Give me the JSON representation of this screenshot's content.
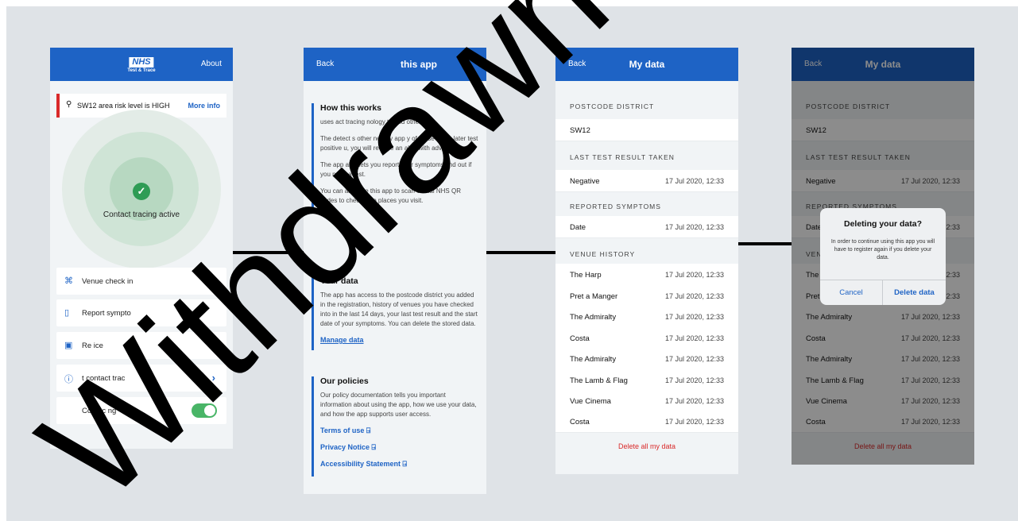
{
  "colors": {
    "nhs_blue": "#1e63c5",
    "alert_red": "#d92a2a",
    "success_green": "#2f9c55",
    "toggle_green": "#49b567"
  },
  "home": {
    "logo_text": "NHS",
    "logo_sub": "Test & Trace",
    "about": "About",
    "risk_text": "SW12 area risk level is HIGH",
    "more_info": "More info",
    "status": "Contact tracing active",
    "menu": [
      {
        "icon": "qr-code-icon",
        "label": "Venue check in"
      },
      {
        "icon": "clipboard-icon",
        "label": "Report sympto"
      },
      {
        "icon": "device-icon",
        "label": "Re              ice"
      },
      {
        "icon": "info-icon",
        "label": "t contact trac"
      }
    ],
    "toggle_label": "Contac          ng"
  },
  "about": {
    "back": "Back",
    "title": "this app",
    "how_title": "How this        works",
    "how_p1": "       uses      act tracing      nology to              and others.",
    "how_p2": "The        detect       s other nearby app        y of those users later test positive          u, you will receive an alert with advic",
    "how_p3": "The app also lets you report your symptoms     find out if you need a test.",
    "how_p4": "You can also use this app to scan official NHS QR codes to check in to places you visit.",
    "data_title": "Your data",
    "data_p": "The app has access to the postcode district you added in the registration, history of venues you have checked into in the last 14 days, your last test result and the start date of your symptoms. You can delete the stored data.",
    "manage": "Manage data",
    "pol_title": "Our policies",
    "pol_p": "Our policy documentation tells you important information about using the app, how we use your data, and how the app supports user access.",
    "terms": "Terms of use ⍈",
    "privacy": "Privacy Notice ⍈",
    "access": "Accessibility Statement ⍈"
  },
  "mydata": {
    "back": "Back",
    "title": "My data",
    "postcode_header": "POSTCODE DISTRICT",
    "postcode": "SW12",
    "test_header": "LAST TEST RESULT TAKEN",
    "test_result": "Negative",
    "test_date": "17 Jul 2020, 12:33",
    "symptoms_header": "REPORTED SYMPTOMS",
    "symptoms_label": "Date",
    "symptoms_date": "17 Jul 2020, 12:33",
    "venue_header": "VENUE HISTORY",
    "venues": [
      {
        "name": "The Harp",
        "date": "17 Jul 2020, 12:33"
      },
      {
        "name": "Pret a Manger",
        "date": "17 Jul 2020, 12:33"
      },
      {
        "name": "The Admiralty",
        "date": "17 Jul 2020, 12:33"
      },
      {
        "name": "Costa",
        "date": "17 Jul 2020, 12:33"
      },
      {
        "name": "The Admiralty",
        "date": "17 Jul 2020, 12:33"
      },
      {
        "name": "The Lamb & Flag",
        "date": "17 Jul 2020, 12:33"
      },
      {
        "name": "Vue Cinema",
        "date": "17 Jul 2020, 12:33"
      },
      {
        "name": "Costa",
        "date": "17 Jul 2020, 12:33"
      }
    ],
    "delete_all": "Delete all my data"
  },
  "dialog": {
    "title": "Deleting your data?",
    "message": "In order to continue using this app you will have to register again if you delete your data.",
    "cancel": "Cancel",
    "delete": "Delete data"
  },
  "watermark": "Withdrawn"
}
